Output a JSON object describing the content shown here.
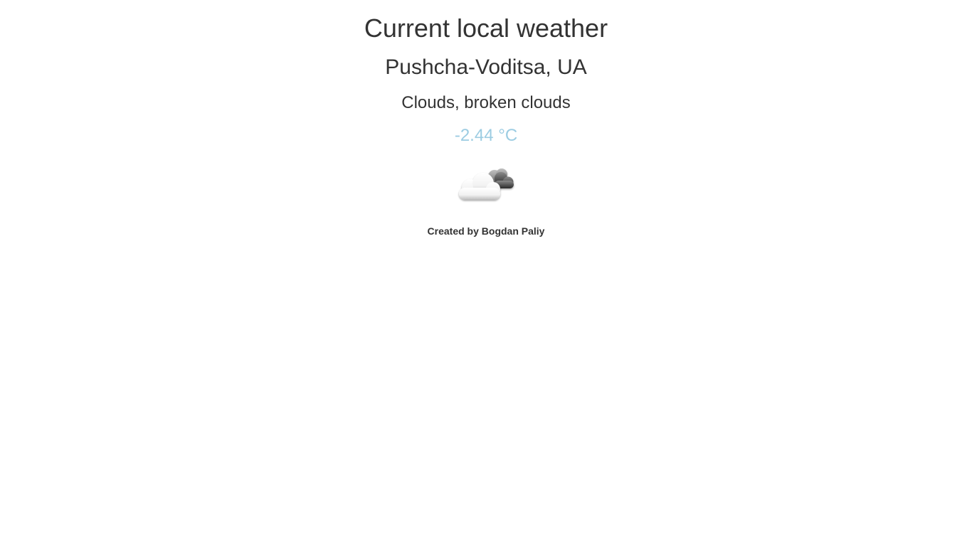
{
  "header": {
    "title": "Current local weather"
  },
  "weather": {
    "location": "Pushcha-Voditsa, UA",
    "condition": "Clouds, broken clouds",
    "temperature": "-2.44 °C",
    "icon": "broken-clouds-icon",
    "temperature_color": "#9ccce2"
  },
  "footer": {
    "credit": "Created by Bogdan Paliy"
  }
}
